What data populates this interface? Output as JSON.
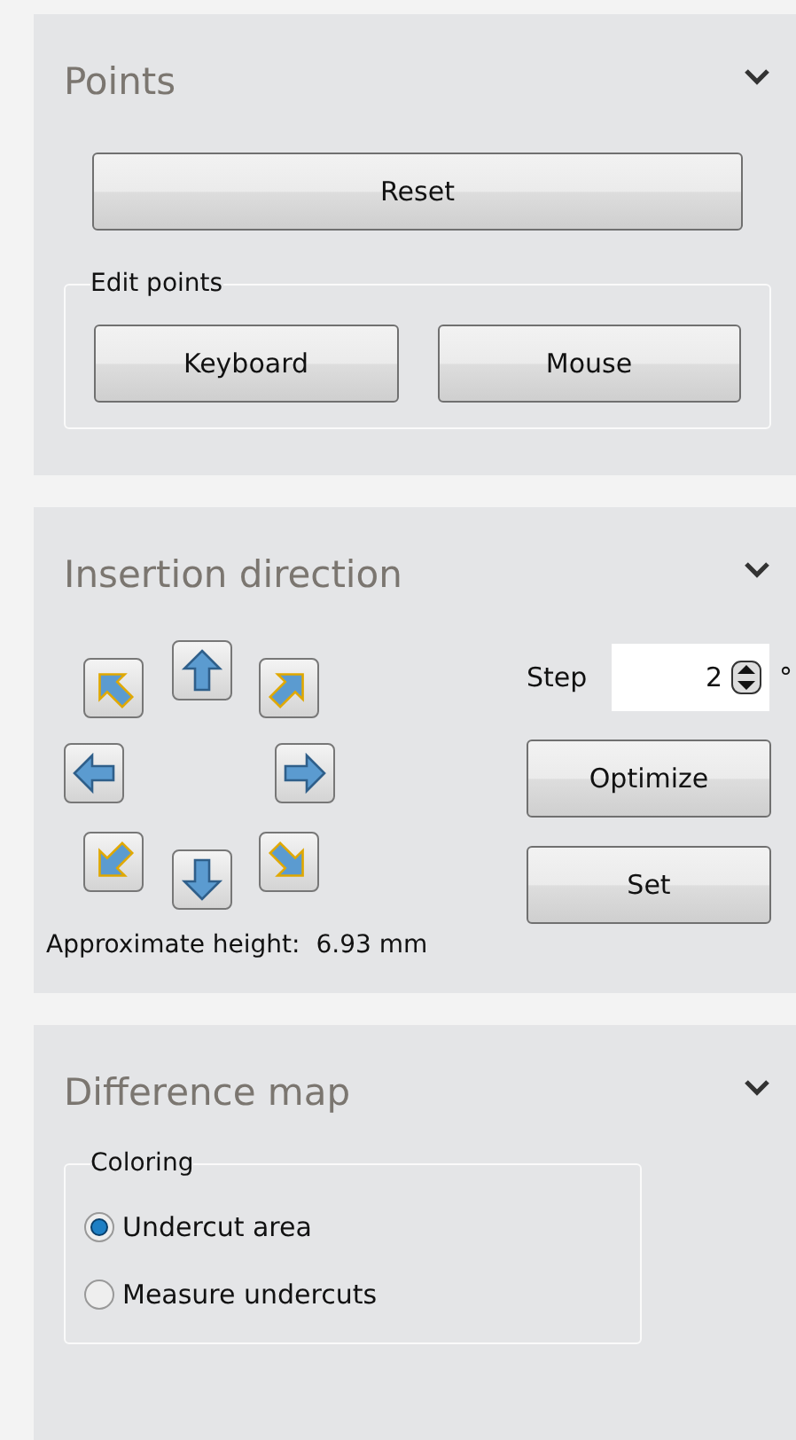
{
  "panels": [
    {
      "kind": "points",
      "title": "Points",
      "reset_button": "Reset",
      "edit_group": {
        "label": "Edit points",
        "buttons": [
          "Keyboard",
          "Mouse"
        ]
      }
    },
    {
      "kind": "insertion",
      "title": "Insertion direction",
      "arrows": [
        {
          "kind": "nw"
        },
        {
          "kind": "n"
        },
        {
          "kind": "ne"
        },
        {
          "kind": "w"
        },
        {
          "kind": "e"
        },
        {
          "kind": "sw"
        },
        {
          "kind": "s"
        },
        {
          "kind": "se"
        }
      ],
      "step_label": "Step",
      "step_value": "2",
      "step_unit": "°",
      "buttons": [
        "Optimize",
        "Set"
      ],
      "height_label": "Approximate height:",
      "height_value": "6.93 mm"
    },
    {
      "kind": "difference",
      "title": "Difference map",
      "coloring_group": {
        "label": "Coloring",
        "options": [
          {
            "label": "Undercut area",
            "selected": true
          },
          {
            "label": "Measure undercuts",
            "selected": false
          }
        ]
      }
    }
  ]
}
